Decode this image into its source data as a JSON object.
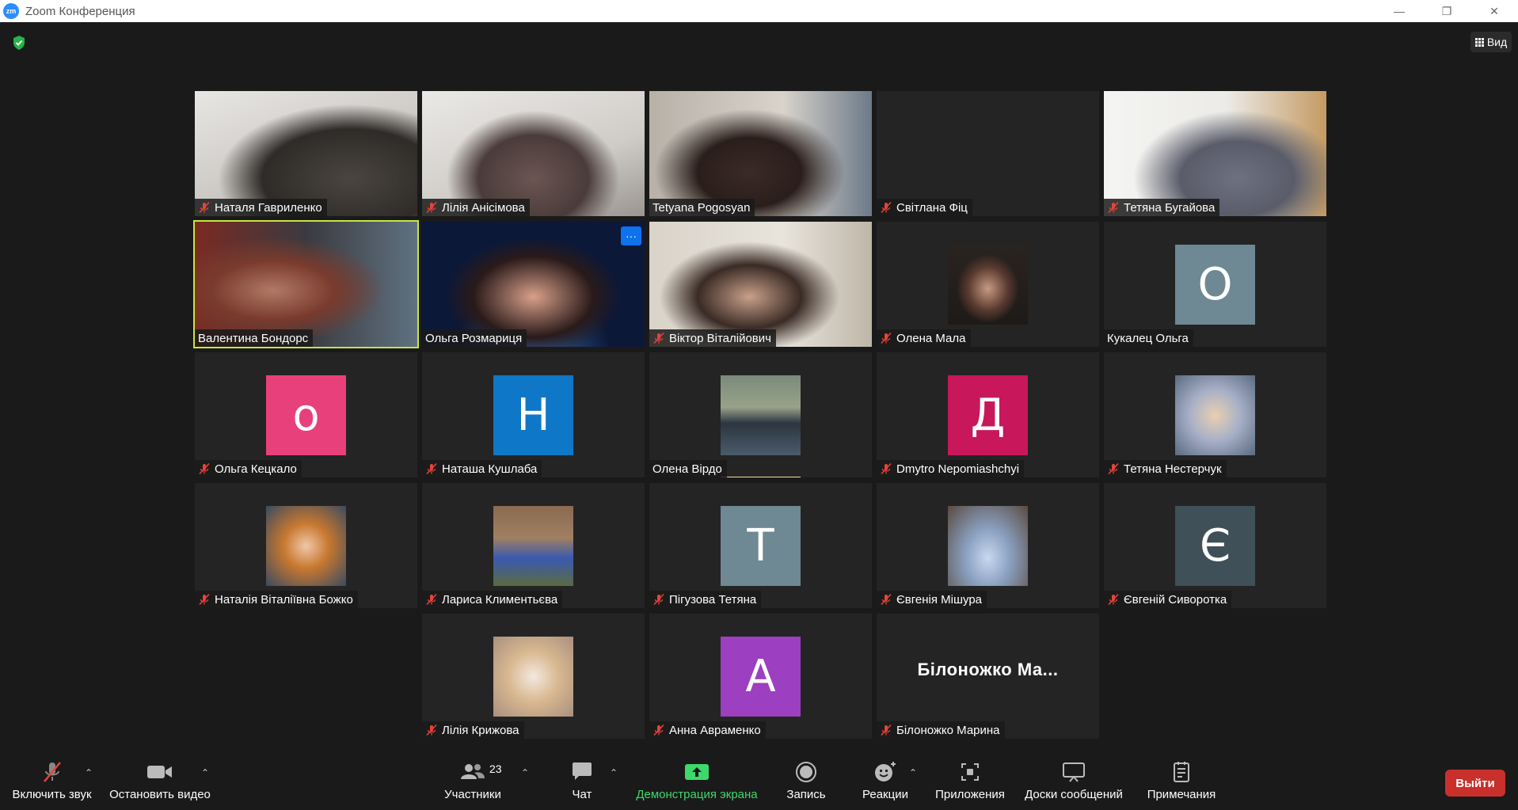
{
  "window": {
    "logo_text": "zm",
    "title": "Zoom Конференция",
    "minimize_glyph": "—",
    "restore_glyph": "❐",
    "close_glyph": "✕"
  },
  "header": {
    "view_label": "Вид"
  },
  "participants": [
    {
      "name": "Наталя Гавриленко",
      "muted": true,
      "kind": "video"
    },
    {
      "name": "Лілія Анісімова",
      "muted": true,
      "kind": "video"
    },
    {
      "name": "Tetyana Pogosyan",
      "muted": false,
      "kind": "video"
    },
    {
      "name": "Світлана Фіц",
      "muted": true,
      "kind": "blank"
    },
    {
      "name": "Тетяна Бугайова",
      "muted": true,
      "kind": "video"
    },
    {
      "name": "Валентина Бондорс",
      "muted": false,
      "kind": "video",
      "active_speaker": true
    },
    {
      "name": "Ольга Розмариця",
      "muted": false,
      "kind": "video",
      "more": "···"
    },
    {
      "name": "Віктор Віталійович",
      "muted": true,
      "kind": "video"
    },
    {
      "name": "Олена Мала",
      "muted": true,
      "kind": "photo"
    },
    {
      "name": "Кукалец Ольга",
      "muted": false,
      "kind": "letter",
      "letter": "O",
      "color": "#6e8894"
    },
    {
      "name": "Ольга Кецкало",
      "muted": true,
      "kind": "letter",
      "letter": "o",
      "color": "#e8407a"
    },
    {
      "name": "Наташа Кушлаба",
      "muted": true,
      "kind": "letter",
      "letter": "Н",
      "color": "#0e77c8"
    },
    {
      "name": "Олена Вірдо",
      "muted": false,
      "kind": "photo",
      "talking": true
    },
    {
      "name": "Dmytro Nepomiashchyi",
      "muted": true,
      "kind": "letter",
      "letter": "Д",
      "color": "#c8175a"
    },
    {
      "name": "Тетяна Нестерчук",
      "muted": true,
      "kind": "photo"
    },
    {
      "name": "Наталія Віталіївна Божко",
      "muted": true,
      "kind": "photo"
    },
    {
      "name": "Лариса Климентьєва",
      "muted": true,
      "kind": "photo"
    },
    {
      "name": "Пігузова Тетяна",
      "muted": true,
      "kind": "letter",
      "letter": "T",
      "color": "#6e8894"
    },
    {
      "name": "Євгенія Мішура",
      "muted": true,
      "kind": "photo"
    },
    {
      "name": "Євгеній Сиворотка",
      "muted": true,
      "kind": "letter",
      "letter": "Є",
      "color": "#3f5058"
    },
    {
      "name": "Лілія Крижова",
      "muted": true,
      "kind": "photo"
    },
    {
      "name": "Анна Авраменко",
      "muted": true,
      "kind": "letter",
      "letter": "A",
      "color": "#9c3fc0"
    },
    {
      "name": "Білоножко Марина",
      "muted": true,
      "kind": "text",
      "display_text": "Білоножко Ма..."
    }
  ],
  "toolbar": {
    "unmute": "Включить звук",
    "stop_video": "Остановить видео",
    "participants": "Участники",
    "participants_count": "23",
    "chat": "Чат",
    "share_screen": "Демонстрация экрана",
    "record": "Запись",
    "reactions": "Реакции",
    "apps": "Приложения",
    "whiteboards": "Доски сообщений",
    "notes": "Примечания",
    "leave": "Выйти",
    "caret": "⌃"
  },
  "colors": {
    "background": "#1a1a1a",
    "tile": "#242424",
    "speaker_outline": "#c8e63c",
    "share_green": "#3fd86b",
    "leave_red": "#c9302c",
    "more_blue": "#0e72ed"
  }
}
